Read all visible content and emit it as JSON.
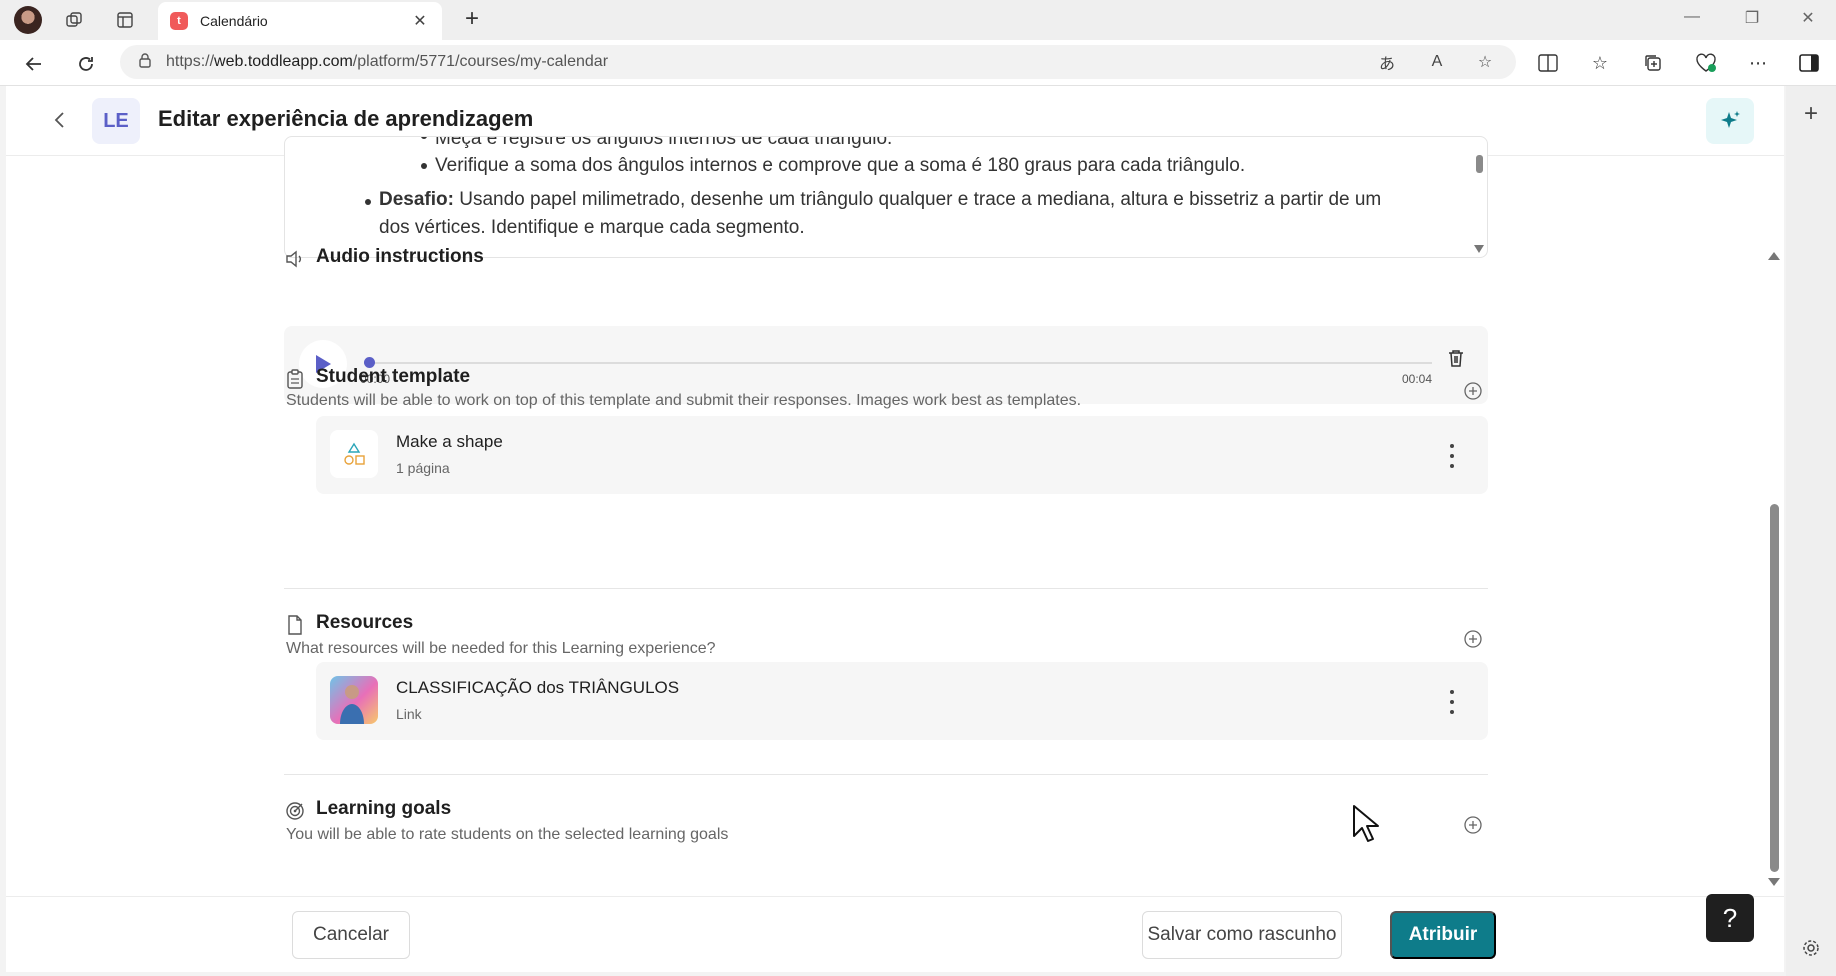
{
  "browser": {
    "tab_title": "Calendário",
    "tab_favicon_letter": "t",
    "url_prefix": "https://",
    "url_host": "web.toddleapp.com",
    "url_path": "/platform/5771/courses/my-calendar",
    "translate_icon_text": "あ",
    "read_aloud_icon_text": "A",
    "icons": [
      "profile-avatar",
      "workspaces-icon",
      "tab-actions-icon",
      "close-icon",
      "new-tab-icon",
      "minimize-icon",
      "maximize-icon",
      "close-window-icon",
      "back-icon",
      "refresh-icon",
      "lock-icon",
      "translate-icon",
      "read-aloud-icon",
      "favorite-star-icon",
      "split-screen-icon",
      "favorites-icon",
      "collections-icon",
      "browser-essentials-icon",
      "more-icon",
      "sidebar-toggle-icon",
      "add-icon",
      "settings-icon"
    ]
  },
  "header": {
    "badge": "LE",
    "title": "Editar experiência de aprendizagem"
  },
  "instructions": {
    "line1": "Meça e registre os ângulos internos de cada triângulo.",
    "line2": "Verifique a soma dos ângulos internos e comprove que a soma é 180 graus para cada triângulo.",
    "challenge_label": "Desafio:",
    "challenge_text": " Usando papel milimetrado, desenhe um triângulo qualquer e trace a mediana, altura e bissetriz a partir de um",
    "challenge_text2": "dos vértices. Identifique e marque cada segmento."
  },
  "audio": {
    "title": "Audio instructions",
    "current_time": "00:00",
    "duration": "00:04",
    "progress": 0
  },
  "student_template": {
    "title": "Student template",
    "description": "Students will be able to work on top of this template and submit their responses. Images work best as templates.",
    "item_title": "Make a shape",
    "item_sub": "1 página"
  },
  "resources": {
    "title": "Resources",
    "description": "What resources will be needed for this Learning experience?",
    "item_title": "CLASSIFICAÇÃO dos TRIÂNGULOS",
    "item_sub": "Link"
  },
  "learning_goals": {
    "title": "Learning goals",
    "description": "You will be able to rate students on the selected learning goals"
  },
  "footer": {
    "cancel": "Cancelar",
    "save_draft": "Salvar como rascunho",
    "assign": "Atribuir",
    "help": "?"
  },
  "colors": {
    "accent": "#5b5fc7",
    "primary": "#0e7c8a",
    "ai_bg": "#e6f7f8"
  }
}
